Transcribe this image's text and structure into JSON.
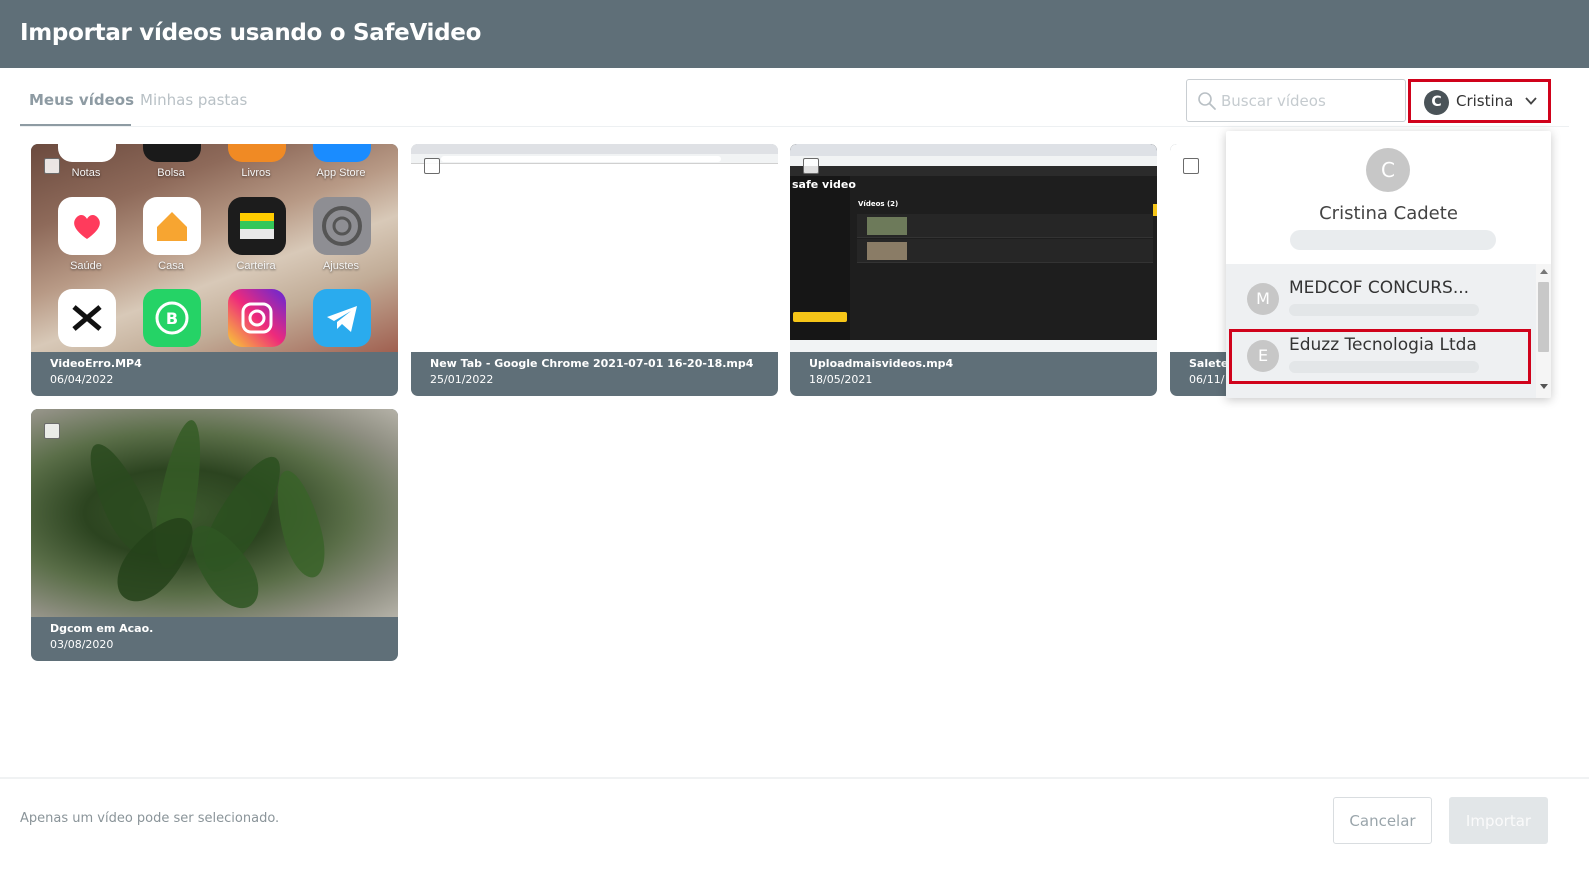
{
  "header": {
    "title": "Importar vídeos usando o SafeVideo"
  },
  "tabs": [
    {
      "label": "Meus vídeos",
      "active": true
    },
    {
      "label": "Minhas pastas",
      "active": false
    }
  ],
  "search": {
    "placeholder": "Buscar vídeos",
    "value": "",
    "icon": "search-icon"
  },
  "account": {
    "initial": "C",
    "name": "Cristina",
    "icon": "chevron-down-icon"
  },
  "dropdown": {
    "initial": "C",
    "full_name": "Cristina Cadete",
    "items": [
      {
        "initial": "M",
        "name": "MEDCOF CONCURS..."
      },
      {
        "initial": "E",
        "name": "Eduzz Tecnologia Ltda"
      }
    ]
  },
  "videos": [
    {
      "name": "VideoErro.MP4",
      "date": "06/04/2022",
      "thumbnail_apps": [
        "Notas",
        "Bolsa",
        "Livros",
        "App Store",
        "Saúde",
        "Casa",
        "Carteira",
        "Ajustes"
      ]
    },
    {
      "name": "New Tab - Google Chrome 2021-07-01 16-20-18.mp4",
      "date": "25/01/2022"
    },
    {
      "name": "Uploadmaisvideos.mp4",
      "date": "18/05/2021",
      "thumbnail_text": {
        "logo": "safe video",
        "section": "Vídeos (2)"
      }
    },
    {
      "name": "Salete.",
      "date": "06/11/"
    },
    {
      "name": "Dgcom em Acao.",
      "date": "03/08/2020"
    }
  ],
  "footer": {
    "note": "Apenas um vídeo pode ser selecionado.",
    "cancel_label": "Cancelar",
    "import_label": "Importar"
  },
  "colors": {
    "header_bg": "#5f6f78",
    "highlight": "#d0021b",
    "card_caption_bg": "#5f6f78"
  }
}
